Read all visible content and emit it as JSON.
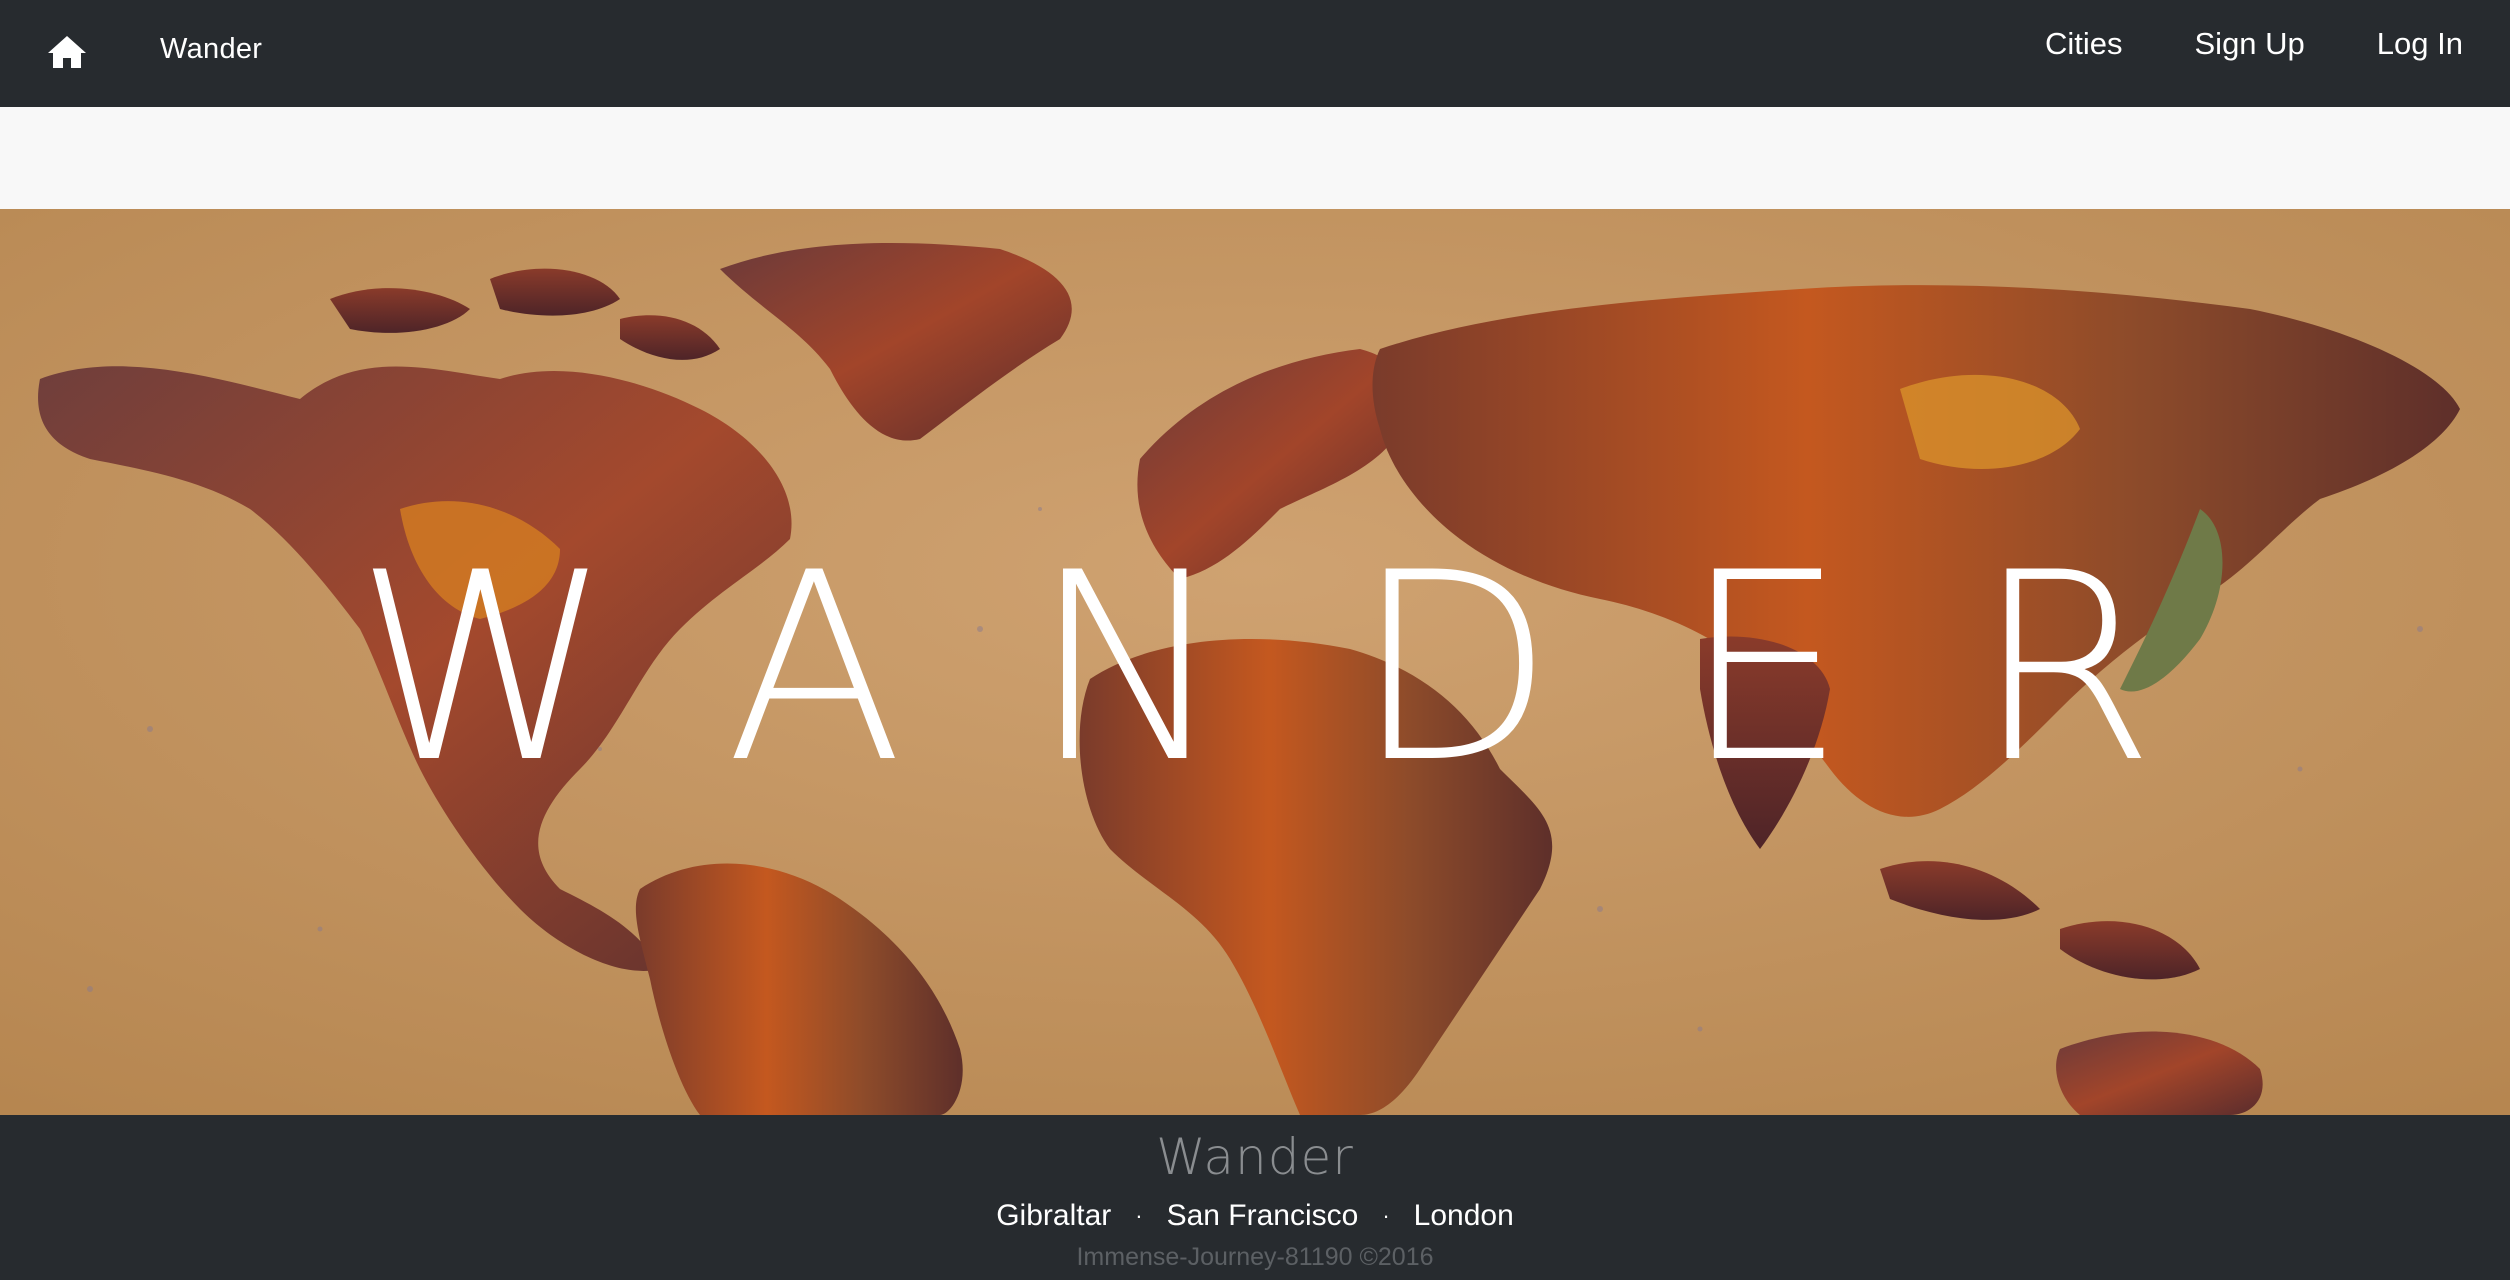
{
  "navbar": {
    "home_icon": "home-icon",
    "brand": "Wander",
    "links": [
      "Cities",
      "Sign Up",
      "Log In"
    ]
  },
  "hero": {
    "title": "WANDER",
    "background": "world-map"
  },
  "footer": {
    "title": "Wander",
    "cities": [
      "Gibraltar",
      "San Francisco",
      "London"
    ],
    "separator": "·",
    "copyright": "Immense-Journey-81190 ©2016"
  },
  "colors": {
    "navbar": "#272b2f",
    "map_background": "#c49563",
    "land_dark": "#5e2f2a",
    "land_orange": "#c8571e"
  }
}
